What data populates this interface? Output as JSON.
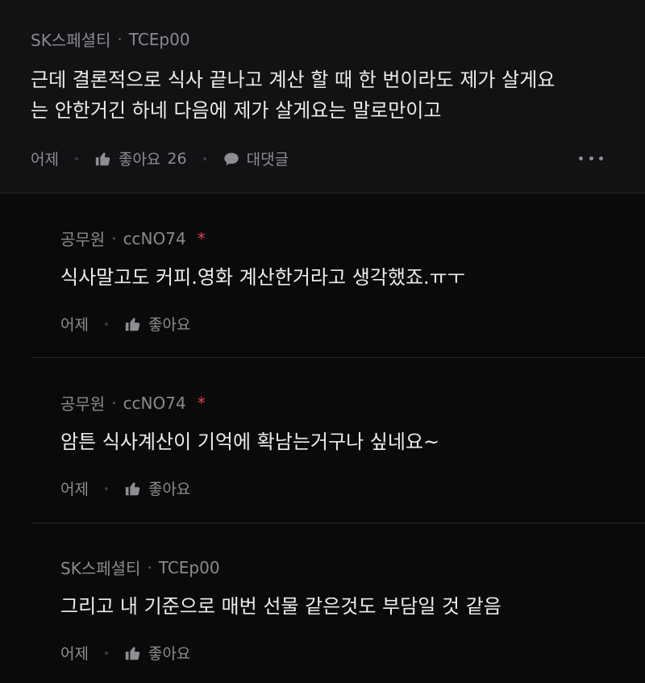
{
  "main": {
    "author": "SK스페셜티",
    "code": "TCEp00",
    "lines": [
      "근데 결론적으로 식사 끝나고 계산 할 때 한 번이라도 제가 살게요",
      "는 안한거긴 하네 다음에 제가 살게요는 말로만이고"
    ],
    "time": "어제",
    "like_label": "좋아요",
    "like_count": "26",
    "reply_label": "대댓글"
  },
  "replies": [
    {
      "author": "공무원",
      "code": "ccNO74",
      "new_mark": "*",
      "text": "식사말고도 커피.영화 계산한거라고 생각했죠.ㅠㅜ",
      "time": "어제",
      "like_label": "좋아요"
    },
    {
      "author": "공무원",
      "code": "ccNO74",
      "new_mark": "*",
      "text": "암튼 식사계산이 기억에 확남는거구나 싶네요~",
      "time": "어제",
      "like_label": "좋아요"
    },
    {
      "author": "SK스페셜티",
      "code": "TCEp00",
      "text": "그리고 내 기준으로 매번 선물 같은것도 부담일 것 같음",
      "time": "어제",
      "like_label": "좋아요"
    }
  ],
  "separator": "·",
  "icons": {
    "like": "thumbs-up-icon",
    "reply": "speech-bubble-icon",
    "more": "more-dots-icon"
  },
  "colors": {
    "background": "#0a0a0b",
    "main_comment_bg": "#121214",
    "text": "#ececee",
    "meta": "#8a8a90",
    "new_mark": "#e0414b"
  }
}
